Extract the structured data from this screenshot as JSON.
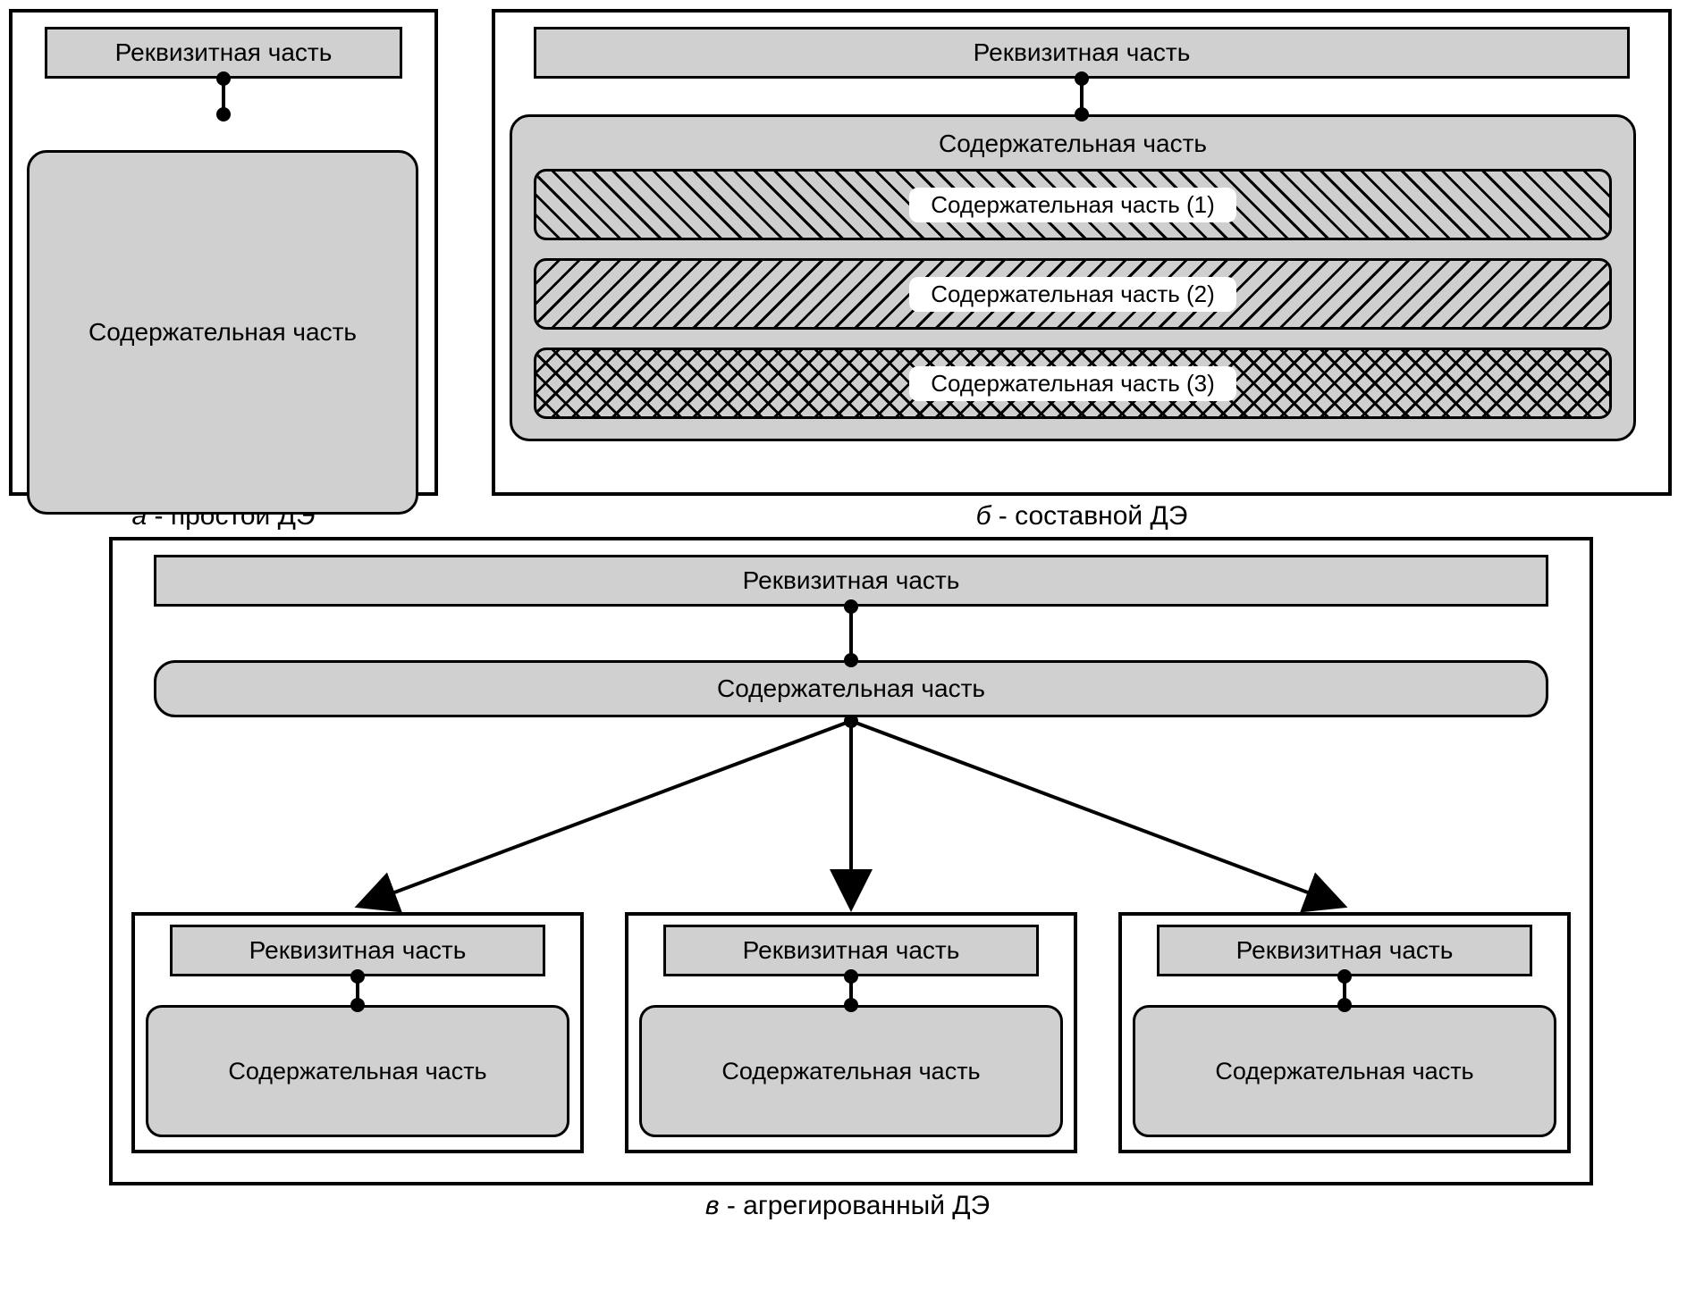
{
  "labels": {
    "requisite": "Реквизитная часть",
    "content": "Содержательная часть",
    "content1": "Содержательная часть (1)",
    "content2": "Содержательная часть (2)",
    "content3": "Содержательная часть (3)"
  },
  "captions": {
    "a_letter": "а",
    "a_text": " - простой ДЭ",
    "b_letter": "б",
    "b_text": " - составной ДЭ",
    "c_letter": "в",
    "c_text": " - агрегированный ДЭ"
  }
}
